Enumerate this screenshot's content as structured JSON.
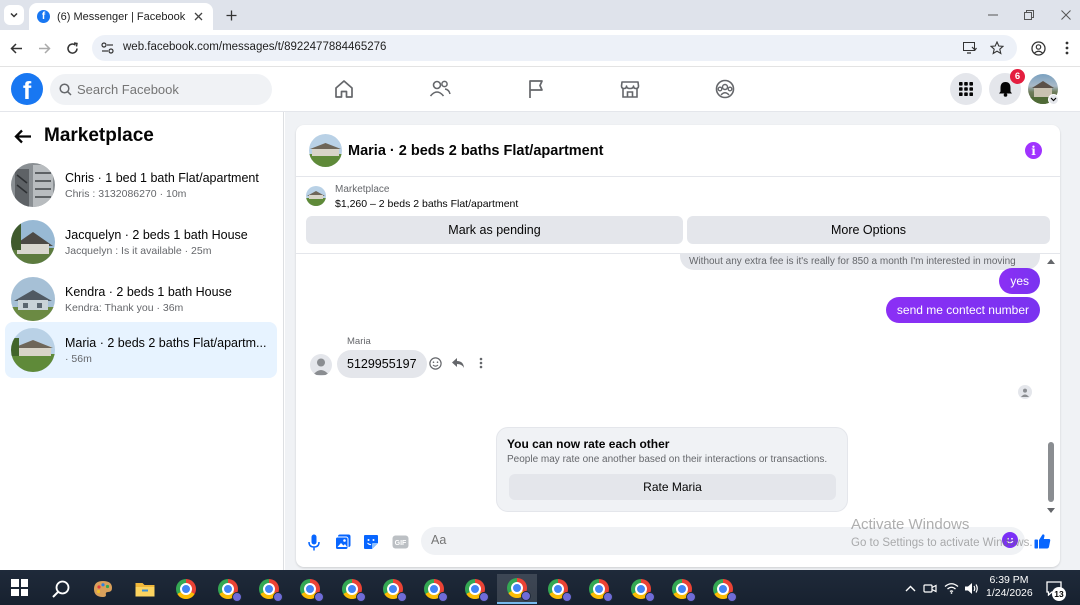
{
  "browser": {
    "tab_title": "(6) Messenger | Facebook",
    "url": "web.facebook.com/messages/t/8922477884465276"
  },
  "fb": {
    "search_placeholder": "Search Facebook",
    "notification_count": "6",
    "nav_icons": [
      "home-icon",
      "friends-icon",
      "pages-flag-icon",
      "marketplace-icon",
      "groups-icon"
    ]
  },
  "sidebar": {
    "title": "Marketplace",
    "conversations": [
      {
        "title": "Chris · 1 bed 1 bath Flat/apartment",
        "subtitle": "Chris : 3132086270 · 10m",
        "active": false
      },
      {
        "title": "Jacquelyn · 2 beds 1 bath House",
        "subtitle": "Jacquelyn : Is it available · 25m",
        "active": false
      },
      {
        "title": "Kendra · 2 beds 1 bath House",
        "subtitle": "Kendra: Thank you · 36m",
        "active": false
      },
      {
        "title": "Maria · 2 beds 2 baths Flat/apartm...",
        "subtitle": "· 56m",
        "active": true
      }
    ]
  },
  "chat": {
    "title": "Maria · 2 beds 2 baths Flat/apartment",
    "listing_label": "Marketplace",
    "listing_detail": "$1,260 – 2 beds 2 baths Flat/apartment",
    "mark_pending_label": "Mark as pending",
    "more_options_label": "More Options",
    "previous_message": "Without any extra fee is it's really for 850 a month I'm interested in moving",
    "sent_messages": [
      "yes",
      "send me contect  number"
    ],
    "sender_name": "Maria",
    "received_message": "5129955197",
    "rating": {
      "title": "You can now rate each other",
      "subtitle": "People may rate one another based on their interactions or transactions.",
      "button": "Rate Maria"
    },
    "composer_placeholder": "Aa",
    "accent_color": "#7b2ff7"
  },
  "watermark": {
    "line1": "Activate Windows",
    "line2": "Go to Settings to activate Windows."
  },
  "taskbar": {
    "time": "6:39 PM",
    "date": "1/24/2026",
    "notification_count": "13"
  }
}
